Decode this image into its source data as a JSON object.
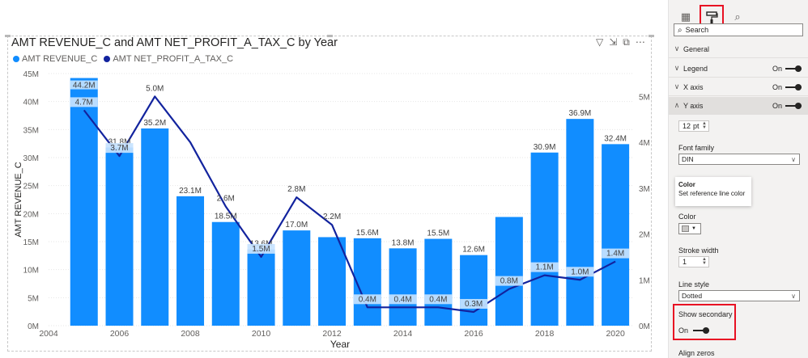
{
  "visual": {
    "title": "AMT REVENUE_C and AMT NET_PROFIT_A_TAX_C by Year",
    "header_icons": [
      "filter-icon",
      "drill-icon",
      "focus-mode-icon",
      "more-options-icon"
    ],
    "legend": [
      {
        "label": "AMT REVENUE_C",
        "color": "#118dff"
      },
      {
        "label": "AMT NET_PROFIT_A_TAX_C",
        "color": "#12239e"
      }
    ]
  },
  "chart_data": {
    "type": "bar",
    "title": "AMT REVENUE_C and AMT NET_PROFIT_A_TAX_C by Year",
    "xlabel": "Year",
    "ylabel": "AMT REVENUE_C",
    "x_ticks": [
      "2004",
      "2006",
      "2008",
      "2010",
      "2012",
      "2014",
      "2016",
      "2018",
      "2020"
    ],
    "x_range": [
      2004,
      2020.5
    ],
    "ylim": [
      0,
      45
    ],
    "y_ticks": [
      "0M",
      "5M",
      "10M",
      "15M",
      "20M",
      "25M",
      "30M",
      "35M",
      "40M",
      "45M"
    ],
    "y2lim": [
      0,
      5.5
    ],
    "y2_ticks": [
      "0M",
      "1M",
      "2M",
      "3M",
      "4M",
      "5M"
    ],
    "years": [
      2005,
      2006,
      2007,
      2008,
      2009,
      2010,
      2011,
      2012,
      2013,
      2014,
      2015,
      2016,
      2017,
      2018,
      2019,
      2020
    ],
    "series": [
      {
        "name": "AMT REVENUE_C",
        "axis": "primary",
        "color": "#118dff",
        "values": [
          44.2,
          31.8,
          35.2,
          23.1,
          18.5,
          13.6,
          17.0,
          15.8,
          15.6,
          13.8,
          15.5,
          12.6,
          19.4,
          30.9,
          36.9,
          32.4
        ],
        "labels": [
          "44.2M",
          "31.8M",
          "35.2M",
          "23.1M",
          "18.5M",
          "13.6M",
          "17.0M",
          "",
          "15.6M",
          "13.8M",
          "15.5M",
          "12.6M",
          "",
          "30.9M",
          "36.9M",
          "32.4M"
        ]
      },
      {
        "name": "AMT NET_PROFIT_A_TAX_C",
        "axis": "secondary",
        "color": "#12239e",
        "values": [
          4.7,
          3.7,
          5.0,
          4.0,
          2.6,
          1.5,
          2.8,
          2.2,
          0.4,
          0.4,
          0.4,
          0.3,
          0.8,
          1.1,
          1.0,
          1.4
        ],
        "labels": [
          "4.7M",
          "3.7M",
          "5.0M",
          "",
          "2.6M",
          "1.5M",
          "2.8M",
          "2.2M",
          "0.4M",
          "0.4M",
          "0.4M",
          "0.3M",
          "0.8M",
          "1.1M",
          "1.0M",
          "1.4M"
        ]
      }
    ],
    "grid": true,
    "legend_position": "top-left"
  },
  "pane": {
    "tabs": [
      "fields-icon",
      "format-paint-icon",
      "analytics-icon"
    ],
    "search_placeholder": "Search",
    "sections": [
      {
        "label": "General",
        "expanded": false
      },
      {
        "label": "Legend",
        "toggle": "On",
        "expanded": false
      },
      {
        "label": "X axis",
        "toggle": "On",
        "expanded": false
      },
      {
        "label": "Y axis",
        "toggle": "On",
        "expanded": true
      }
    ],
    "font_size": {
      "value": "12",
      "unit": "pt"
    },
    "font_family": {
      "label": "Font family",
      "value": "DIN"
    },
    "tooltip": {
      "title": "Color",
      "text": "Set reference line color"
    },
    "color": {
      "label": "Color",
      "value": "#c8c6c4"
    },
    "stroke_width": {
      "label": "Stroke width",
      "value": "1"
    },
    "line_style": {
      "label": "Line style",
      "value": "Dotted"
    },
    "show_secondary": {
      "label": "Show secondary",
      "value": "On"
    },
    "align_zeros": {
      "label": "Align zeros"
    }
  }
}
